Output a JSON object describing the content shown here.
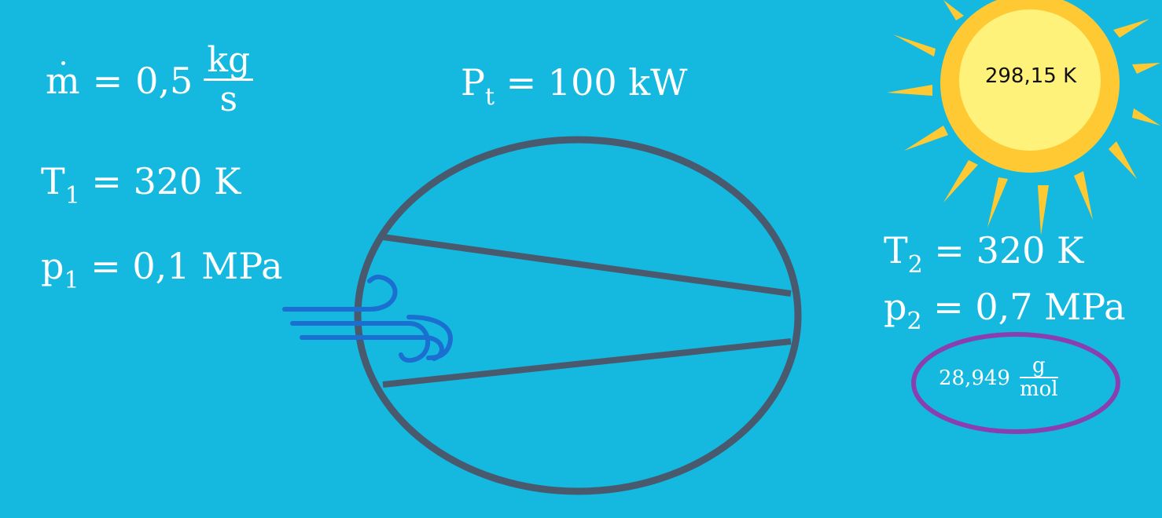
{
  "left_values": {
    "mass_flow": {
      "symbol": "m",
      "equals": "=",
      "value": "0,5",
      "unit_num": "kg",
      "unit_den": "s"
    },
    "t1": {
      "symbol": "T",
      "sub": "1",
      "text": "= 320 K"
    },
    "p1": {
      "symbol": "p",
      "sub": "1",
      "text": "= 0,1 MPa"
    }
  },
  "power": {
    "symbol": "P",
    "sub": "t",
    "text": "= 100 kW"
  },
  "sun": {
    "label": "298,15 K"
  },
  "right_values": {
    "t2": {
      "symbol": "T",
      "sub": "2",
      "text": "= 320 K"
    },
    "p2": {
      "symbol": "p",
      "sub": "2",
      "text": "= 0,7 MPa"
    },
    "molar_mass": {
      "value": "28,949",
      "unit_num": "g",
      "unit_den": "mol"
    }
  },
  "colors": {
    "background": "#15b9e0",
    "compressor_outline": "#4a5a6e",
    "wind": "#1a6fd0",
    "sun_rays": "#ffc933",
    "sun_outer": "#ffc933",
    "sun_inner": "#fff27a",
    "highlight_ring": "#8a3fb0"
  },
  "icons": [
    "compressor-icon",
    "wind-icon",
    "sun-icon"
  ]
}
